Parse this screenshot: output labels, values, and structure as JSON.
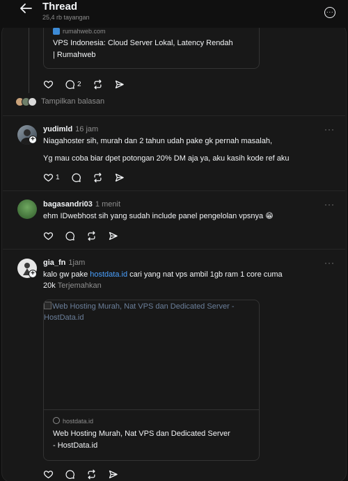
{
  "header": {
    "title": "Thread",
    "views": "25,4 rb tayangan"
  },
  "top_card": {
    "domain": "rumahweb.com",
    "title_line1": "VPS Indonesia: Cloud Server Lokal, Latency Rendah",
    "title_line2": "| Rumahweb"
  },
  "top_actions": {
    "reply_count": "2"
  },
  "show_replies": "Tampilkan balasan",
  "posts": [
    {
      "username": "yudimld",
      "time": "16 jam",
      "line1": "Niagahoster sih, murah dan 2 tahun udah pake gk pernah masalah,",
      "line2": "Yg mau coba biar dpet potongan 20% DM aja ya, aku kasih kode ref aku",
      "like_count": "1"
    },
    {
      "username": "bagasandri03",
      "time": "1 menit",
      "line1": "ehm IDwebhost sih yang sudah include panel pengelolan vpsnya 😁"
    },
    {
      "username": "gia_fn",
      "time": "1jam",
      "pre_link": "kalo gw pake ",
      "link": "hostdata.id",
      "post_link": " cari yang nat vps ambil 1gb ram 1 core cuma",
      "line2": "20k",
      "translate": "Terjemahkan",
      "card": {
        "image_alt_line1": "Web Hosting Murah, Nat VPS dan Dedicated Server -",
        "image_alt_line2": "HostData.id",
        "domain": "hostdata.id",
        "title_line1": "Web Hosting Murah, Nat VPS dan Dedicated Server",
        "title_line2": "- HostData.id"
      }
    }
  ]
}
